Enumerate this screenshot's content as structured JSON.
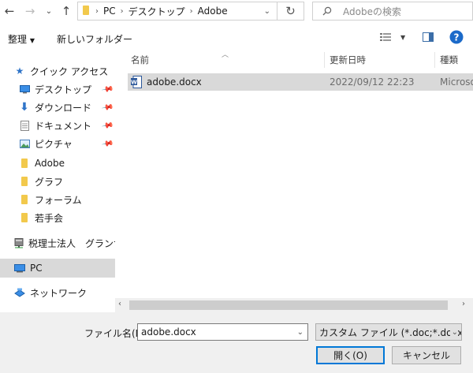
{
  "address": {
    "crumbs": [
      "PC",
      "デスクトップ",
      "Adobe"
    ]
  },
  "search": {
    "placeholder": "Adobeの検索"
  },
  "toolbar": {
    "organize": "整理",
    "new_folder": "新しいフォルダー"
  },
  "nav": {
    "quick_access": "クイック アクセス",
    "items": [
      {
        "label": "デスクトップ",
        "icon": "desktop-icon",
        "pinned": true
      },
      {
        "label": "ダウンロード",
        "icon": "download-icon",
        "pinned": true
      },
      {
        "label": "ドキュメント",
        "icon": "document-icon",
        "pinned": true
      },
      {
        "label": "ピクチャ",
        "icon": "picture-icon",
        "pinned": true
      },
      {
        "label": "Adobe",
        "icon": "folder-icon"
      },
      {
        "label": "グラフ",
        "icon": "folder-icon"
      },
      {
        "label": "フォーラム",
        "icon": "folder-icon"
      },
      {
        "label": "若手会",
        "icon": "folder-icon"
      }
    ],
    "network_drive": "税理士法人　グランサー",
    "pc": "PC",
    "network": "ネットワーク"
  },
  "columns": {
    "name": "名前",
    "date": "更新日時",
    "type": "種類"
  },
  "files": [
    {
      "name": "adobe.docx",
      "date": "2022/09/12 22:23",
      "type": "Microso"
    }
  ],
  "bottom": {
    "filename_label": "ファイル名(N):",
    "filename_value": "adobe.docx",
    "filter": "カスタム ファイル (*.doc;*.docx;*.rtf;",
    "open": "開く(O)",
    "cancel": "キャンセル"
  }
}
